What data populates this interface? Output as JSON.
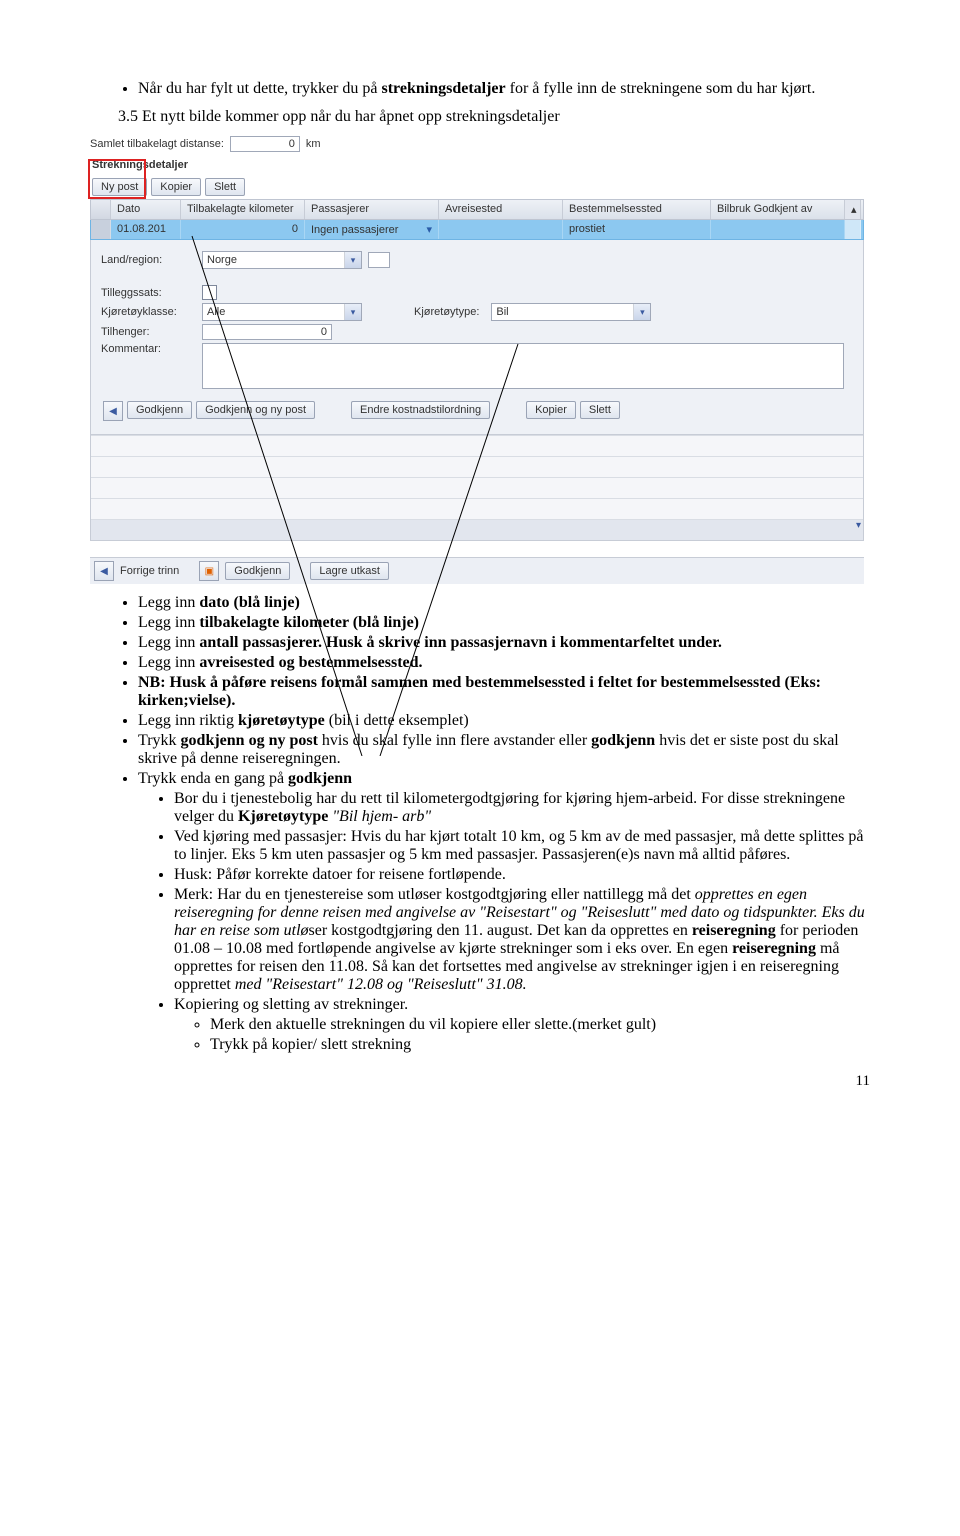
{
  "top_bullets": {
    "line1_a": "Når du har fylt ut dette, trykker du på ",
    "line1_bold": "strekningsdetaljer",
    "line1_b": " for å fylle inn de strekningene som du har kjørt."
  },
  "step3": "3.5 Et nytt bilde kommer opp når du har åpnet opp strekningsdetaljer",
  "app": {
    "samlet_label": "Samlet tilbakelagt distanse:",
    "samlet_value": "0",
    "km": "km",
    "section": "Strekningsdetaljer",
    "btn_ny": "Ny post",
    "btn_kopier": "Kopier",
    "btn_slett": "Slett",
    "head": {
      "dato": "Dato",
      "km": "Tilbakelagte kilometer",
      "pass": "Passasjerer",
      "avr": "Avreisested",
      "best": "Bestemmelsessted",
      "bil": "Bilbruk Godkjent av"
    },
    "row": {
      "dato": "01.08.201",
      "km": "0",
      "pass": "Ingen passasjerer",
      "best": "prostiet"
    },
    "detail": {
      "land_label": "Land/region:",
      "land_value": "Norge",
      "tillegg_label": "Tilleggssats:",
      "kjklasse_label": "Kjøretøyklasse:",
      "kjklasse_value": "Alle",
      "kjtype_label": "Kjøretøytype:",
      "kjtype_value": "Bil",
      "tilhenger_label": "Tilhenger:",
      "tilhenger_value": "0",
      "kommentar_label": "Kommentar:",
      "btn_godkjenn": "Godkjenn",
      "btn_godkjenn_ny": "Godkjenn og ny post",
      "btn_endre": "Endre kostnadstilordning",
      "btn_kopier": "Kopier",
      "btn_slett": "Slett"
    },
    "bottom": {
      "forrige": "Forrige trinn",
      "godkjenn": "Godkjenn",
      "lagre": "Lagre utkast"
    }
  },
  "guide": {
    "l1_a": "Legg inn ",
    "l1_b": "dato (blå linje)",
    "l2_a": "Legg inn ",
    "l2_b": "tilbakelagte kilometer (blå linje)",
    "l3_a": "Legg inn ",
    "l3_b": "antall passasjerer. Husk å skrive inn passasjernavn i kommentarfeltet under.",
    "l4_a": "Legg inn ",
    "l4_b": "avreisested og bestemmelsessted.",
    "l5": "NB: Husk å påføre reisens formål sammen med bestemmelsessted i feltet for bestemmelsessted (Eks: kirken;vielse).",
    "l6_a": "Legg inn riktig ",
    "l6_b": "kjøretøytype",
    "l6_c": " (bil i dette eksemplet)",
    "l7_a": "Trykk ",
    "l7_b": "godkjenn og ny post",
    "l7_c": " hvis du skal fylle inn flere avstander eller ",
    "l7_d": "godkjenn",
    "l7_e": " hvis det er siste post du skal skrive på denne reiseregningen.",
    "l8_a": "Trykk enda en gang på ",
    "l8_b": "godkjenn",
    "l9_a": "Bor du i tjenestebolig har du rett til kilometergodtgjøring for kjøring hjem-arbeid. For disse strekningene velger du ",
    "l9_b": "Kjøretøytype",
    "l9_c": " \"Bil hjem- arb\"",
    "l10": "Ved kjøring med passasjer: Hvis du har kjørt totalt 10 km, og 5 km av de med passasjer, må dette splittes på to linjer. Eks 5 km uten passasjer og 5 km med passasjer. Passasjeren(e)s navn må alltid påføres.",
    "l11": "Husk: Påfør korrekte datoer for reisene fortløpende.",
    "l12_a": "Merk: Har du en tjenestereise som utløser kostgodtgjøring eller nattillegg må det ",
    "l12_it": "opprettes en egen reiseregning for denne reisen med angivelse av \"Reisestart\" og \"Reiseslutt\" med dato og tidspunkter. Eks du har en reise som utlø",
    "l12_b": "ser kostgodtgjøring den 11. august. Det kan da opprettes en ",
    "l12_bold1": "reiseregning",
    "l12_c": " for perioden 01.08 – 10.08 med fortløpende angivelse av kjørte strekninger som i eks over. En egen ",
    "l12_bold2": "reiseregning",
    "l12_d": " må opprettes for reisen den 11.08. Så kan det fortsettes med angivelse av strekninger igjen i en reiseregning opprettet ",
    "l12_it2": "med \"Reisestart\" 12.08 og \"Reiseslutt\" 31.08.",
    "l13": "Kopiering og sletting av strekninger.",
    "l13a": "Merk den aktuelle strekningen du vil kopiere eller slette.(merket gult)",
    "l13b": "Trykk på kopier/ slett strekning"
  },
  "pagenum": "11"
}
